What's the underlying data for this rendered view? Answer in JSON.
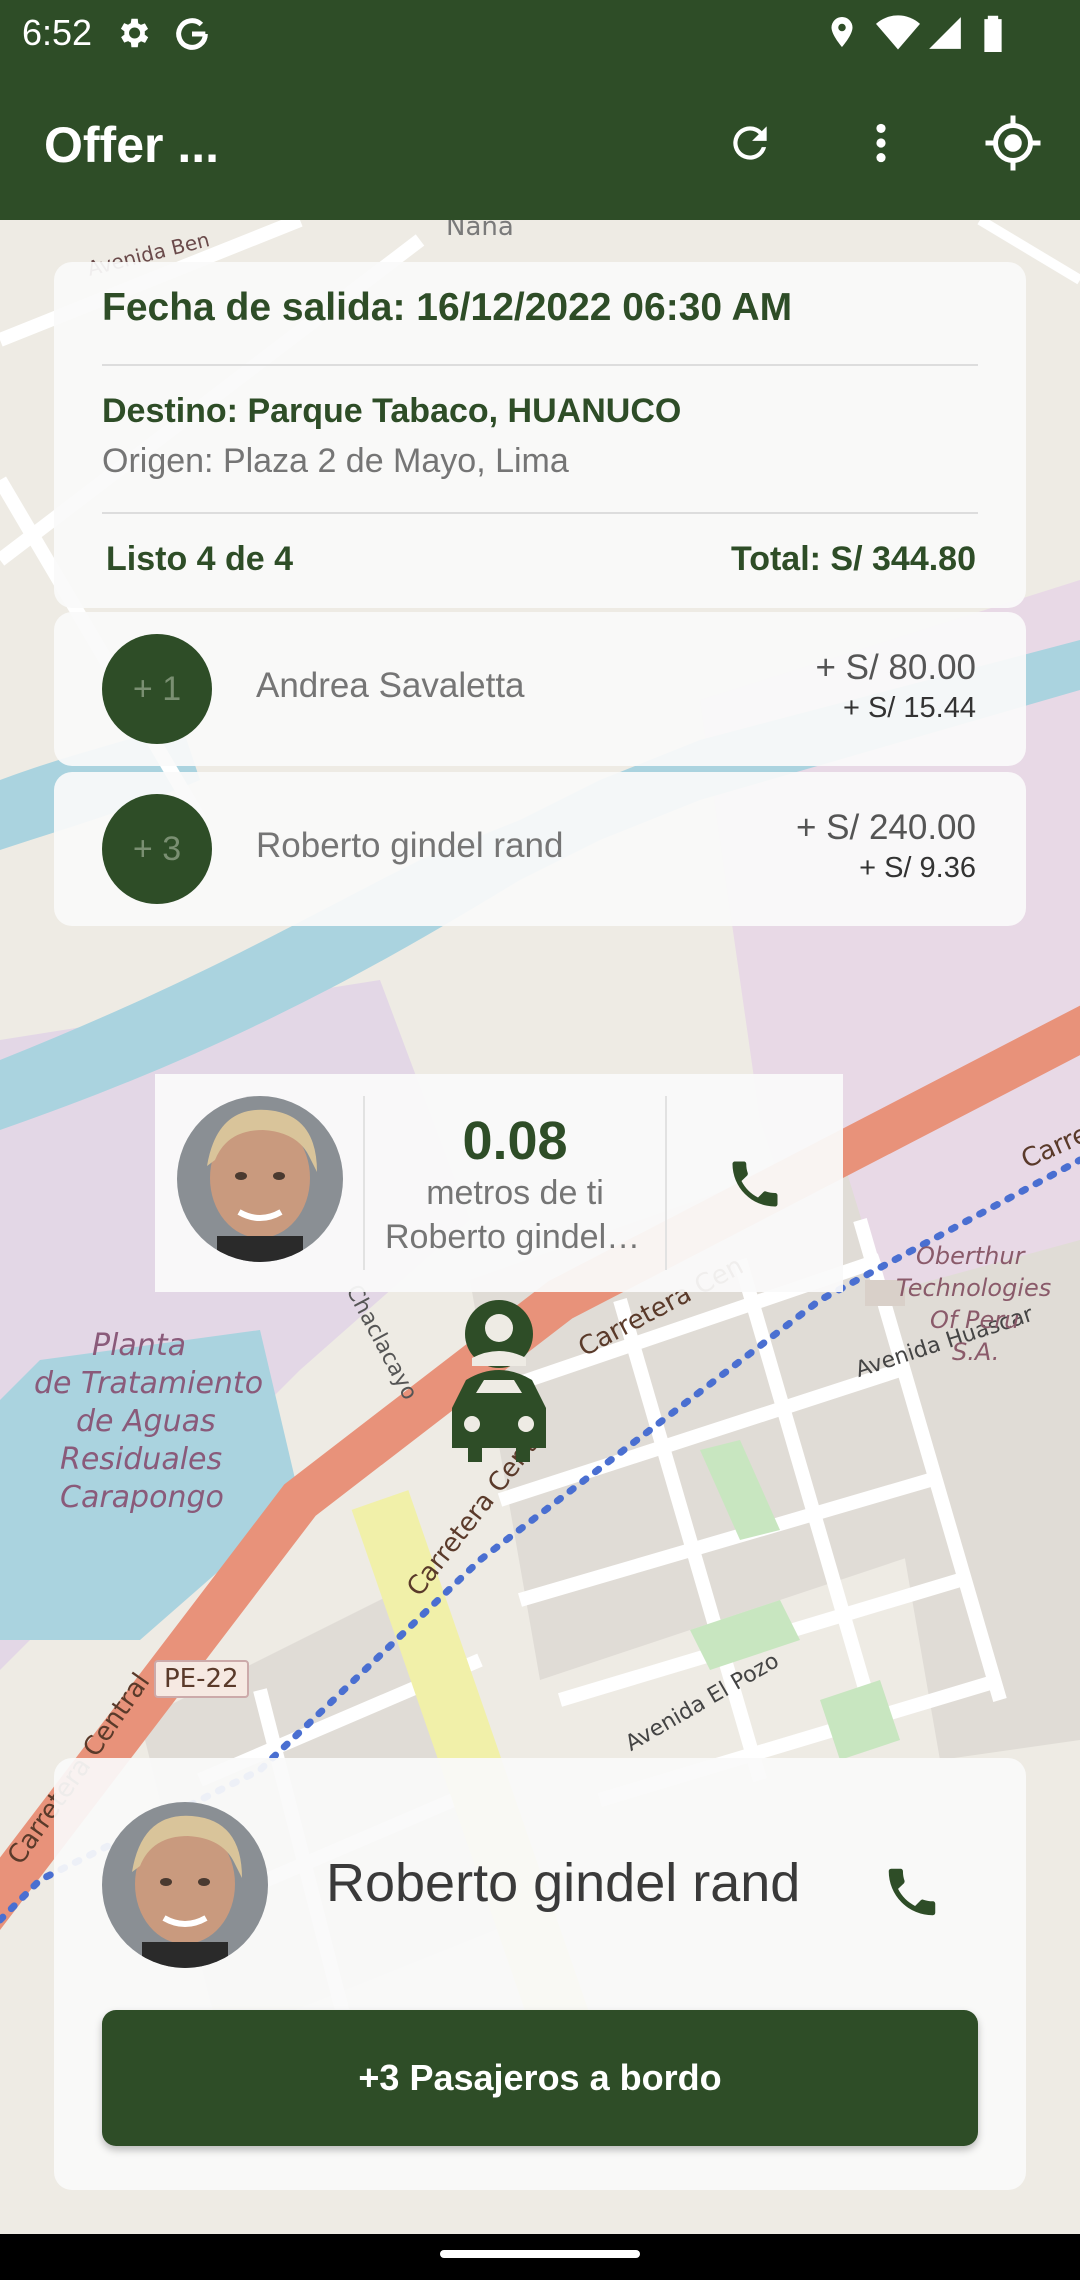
{
  "status_bar": {
    "time": "6:52"
  },
  "app_bar": {
    "title": "Offer ..."
  },
  "map": {
    "labels": {
      "avenida_ben": "Avenida Ben",
      "nana": "Nana",
      "avenida_huascar": "Avenida Huascar",
      "oberthur_1": "Oberthur",
      "oberthur_2": "Technologies",
      "oberthur_3": "Of Peru",
      "oberthur_4": "S.A.",
      "planta_1": "Planta",
      "planta_2": "de Tratamiento",
      "planta_3": "de Aguas",
      "planta_4": "Residuales",
      "planta_5": "Carapongo",
      "carretera_1": "Carretera Cen",
      "carretera_2": "Carretera Centr",
      "carretera_3": "Carretera Central",
      "carretera_4": "Carre",
      "chaclacayo": "Chaclacayo",
      "avenida_el_pozo": "Avenida El Pozo",
      "pe22": "PE-22"
    }
  },
  "trip": {
    "fecha": "Fecha de salida: 16/12/2022 06:30 AM",
    "destino": "Destino: Parque Tabaco, HUANUCO",
    "origen": "Origen: Plaza 2 de Mayo, Lima",
    "listo": "Listo 4 de 4",
    "total": "Total: S/ 344.80"
  },
  "passengers": [
    {
      "count": "+ 1",
      "name": "Andrea Savaletta",
      "amount": "+ S/ 80.00",
      "extra": "+ S/ 15.44"
    },
    {
      "count": "+ 3",
      "name": "Roberto gindel rand",
      "amount": "+ S/ 240.00",
      "extra": "+ S/ 9.36"
    }
  ],
  "distance_card": {
    "value": "0.08",
    "label": "metros de ti",
    "name": "Roberto gindel rand"
  },
  "bottom_card": {
    "name": "Roberto gindel rand",
    "board_button": "+3 Pasajeros a bordo"
  },
  "colors": {
    "primary": "#2e4d27",
    "route": "#4a6fd1",
    "road": "#e8927a"
  },
  "icons": [
    "settings-icon",
    "google-icon",
    "location-pin-icon",
    "wifi-icon",
    "signal-icon",
    "battery-icon",
    "refresh-icon",
    "more-vert-icon",
    "my-location-icon",
    "phone-icon",
    "driver-car-icon"
  ]
}
